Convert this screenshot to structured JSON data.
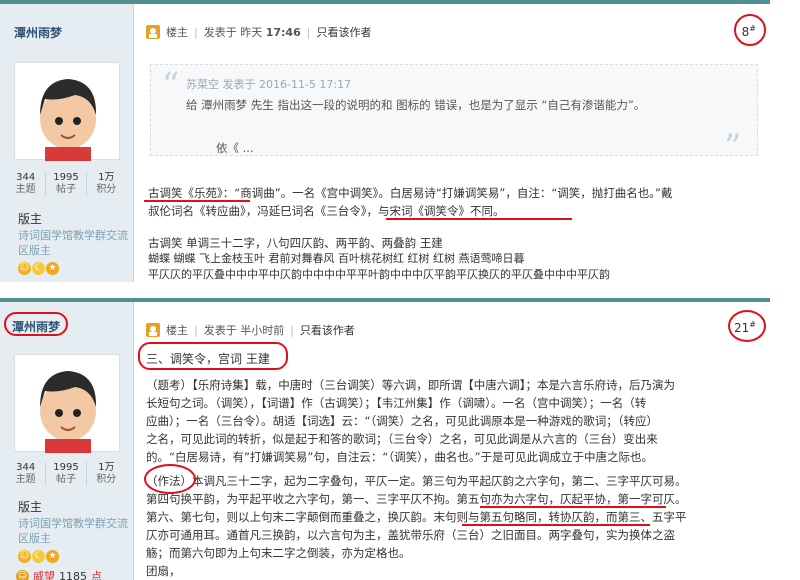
{
  "post1": {
    "username": "潭州雨梦",
    "stats": [
      {
        "n": "344",
        "l": "主题"
      },
      {
        "n": "1995",
        "l": "帖子"
      },
      {
        "n": "1万",
        "l": "积分"
      }
    ],
    "rank": "版主",
    "group": "诗词国学馆教学群交流区版主",
    "owner_label": "楼主",
    "posted_label": "发表于 昨天",
    "posted_time": "17:46",
    "only_author": "只看该作者",
    "floor_num": "8",
    "floor_sup": "#",
    "quote_head": "苏菜空 发表于 2016-11-5 17:17",
    "quote_text": "给 潭州雨梦 先生 指出这一段的说明的和 图标的 错误，也是为了显示 “自己有渗谐能力”。",
    "quote_tail": "依《 ...",
    "para1_line1": "古调笑《乐苑》：“商调曲”。一名《宫中调笑》。白居易诗“打嫌调笑易”，自注：“调笑，抛打曲名也。”戴",
    "para1_line2": "叔伦词名《转应曲》，冯延巳词名《三台令》，与宋词《调笑令》不同。",
    "para2_line1": "古调笑 单调三十二字，八句四仄韵、两平韵、两叠韵 王建",
    "para2_line2": "      蝴蝶        蝴蝶    飞上金枝玉叶    君前对舞春风        百叶桃花树红    红树            红树    燕语莺啼日暮",
    "para2_line3": "      平仄仄的平仄叠中中中平中仄韵中中中中平平叶韵中中中仄平韵平仄换仄的平仄叠中中中平仄韵"
  },
  "post2": {
    "username": "潭州雨梦",
    "stats": [
      {
        "n": "344",
        "l": "主题"
      },
      {
        "n": "1995",
        "l": "帖子"
      },
      {
        "n": "1万",
        "l": "积分"
      }
    ],
    "rank": "版主",
    "group": "诗词国学馆教学群交流区版主",
    "owner_label": "楼主",
    "posted_label": "发表于 半小时前",
    "only_author": "只看该作者",
    "floor_num": "21",
    "floor_sup": "#",
    "section_title": "三、调笑令，宫词 王建",
    "kaozheng": [
      "（题考）【乐府诗集】载，中唐时（三台调笑）等六调，即所谓【中唐六调】；本是六言乐府诗，后乃演为",
      "长短句之词。（调笑），【词谱】作（古调笑）；【韦江州集】作（调啸）。一名（宫中调笑）；一名（转",
      "应曲）；一名（三台令）。胡适【词选】云：“（调笑）之名，可见此调原本是一种游戏的歌词；（转应）",
      "之名，可见此词的转折，似是起于和答的歌词；（三台令）之名，可见此调是从六言的（三台）变出来",
      "的。“白居易诗，有”打嫌调笑易”句，自注云：“（调笑），曲名也。”于是可见此调成立于中唐之际也。"
    ],
    "zuofa": [
      "（作法）本调凡三十二字，起为二字叠句，平仄一定。第三句为平起仄韵之六字句，第二、三字平仄可易。",
      "第四句换平韵，为平起平收之六字句，第一、三字平仄不拘。第五句亦为六字句，仄起平协，第一字可仄。",
      "第六、第七句，则以上句末二字颠倒而重叠之，换仄韵。末句则与第五句略同，转协仄韵，而第三、五字平",
      "仄亦可通用耳。通首凡三换韵，以六言句为主，盖犹带乐府（三台）之旧面目。两字叠句，实为换体之盗",
      "觞；而第六句即为上句末二字之倒装，亦为定格也。",
      "团扇，"
    ],
    "medal_label": "威望",
    "points_value": "1185",
    "points_unit": "点"
  }
}
